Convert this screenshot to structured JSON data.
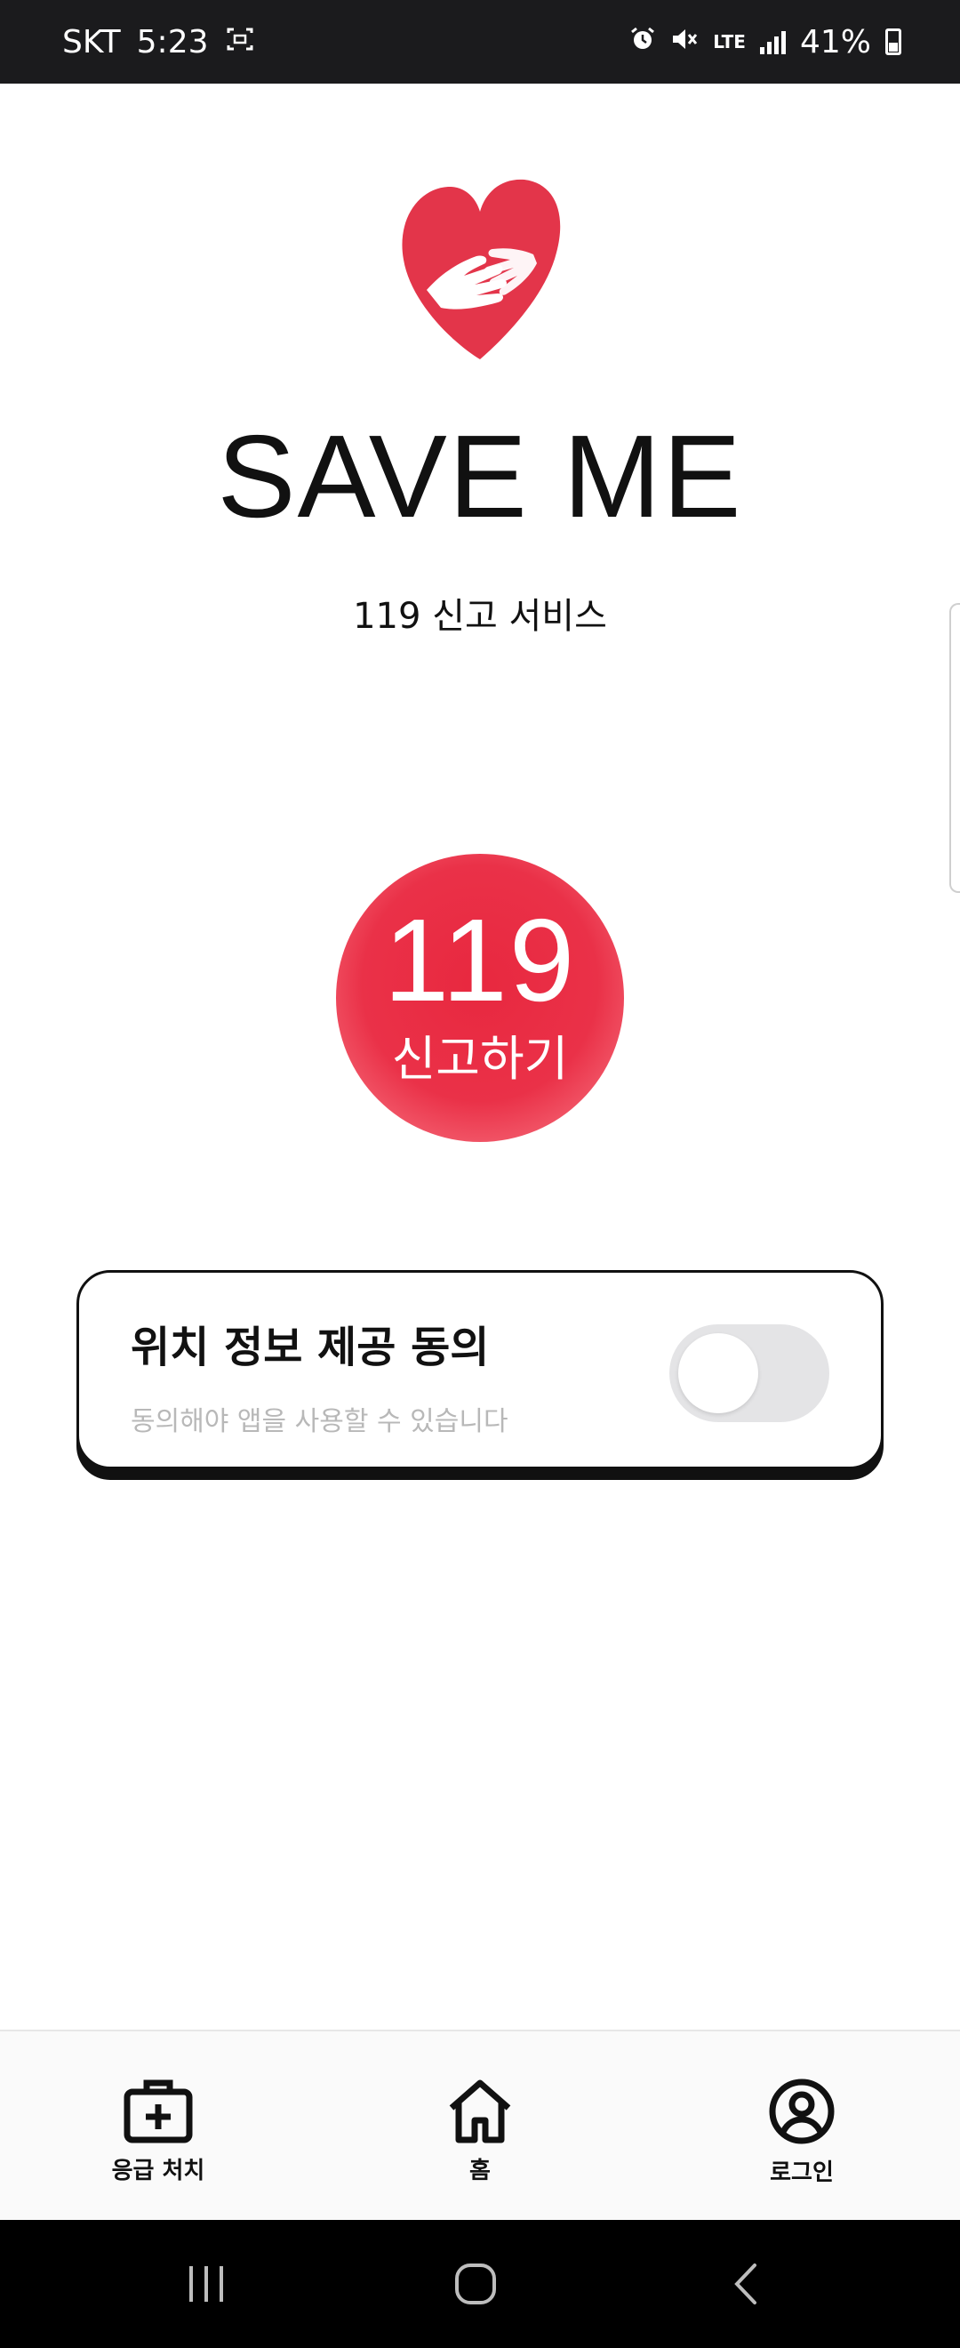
{
  "status_bar": {
    "carrier": "SKT",
    "time": "5:23",
    "network": "LTE",
    "battery": "41%",
    "icons": [
      "screen-record-icon",
      "alarm-icon",
      "mute-icon",
      "lte-icon",
      "signal-icon",
      "battery-icon"
    ]
  },
  "app": {
    "title": "SAVE ME",
    "subtitle": "119 신고 서비스",
    "logo_icon": "heart-hands-logo"
  },
  "call_button": {
    "number": "119",
    "label": "신고하기",
    "color": "#e8283f"
  },
  "consent": {
    "title": "위치 정보 제공 동의",
    "description": "동의해야 앱을 사용할 수 있습니다",
    "enabled": false
  },
  "bottom_nav": {
    "items": [
      {
        "label": "응급 처치",
        "icon": "first-aid-kit-icon"
      },
      {
        "label": "홈",
        "icon": "home-icon"
      },
      {
        "label": "로그인",
        "icon": "user-circle-icon"
      }
    ]
  },
  "system_nav": {
    "icons": [
      "recent-apps-icon",
      "home-circle-icon",
      "back-icon"
    ]
  }
}
